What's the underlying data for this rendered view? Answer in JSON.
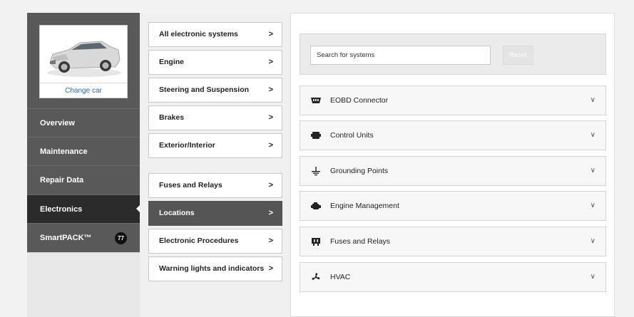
{
  "vehicle": {
    "change_label": "Change car"
  },
  "sidebar": {
    "items": [
      {
        "label": "Overview"
      },
      {
        "label": "Maintenance"
      },
      {
        "label": "Repair Data"
      },
      {
        "label": "Electronics"
      },
      {
        "label": "SmartPACK™",
        "badge": "77"
      }
    ],
    "active": "Electronics"
  },
  "submenu": {
    "items": [
      {
        "label": "All electronic systems"
      },
      {
        "label": "Engine"
      },
      {
        "label": "Steering and Suspension"
      },
      {
        "label": "Brakes"
      },
      {
        "label": "Exterior/Interior"
      },
      {
        "label": "Fuses and Relays"
      },
      {
        "label": "Locations"
      },
      {
        "label": "Electronic Procedures"
      },
      {
        "label": "Warning lights and indicators"
      }
    ],
    "chevron": ">",
    "active": "Locations"
  },
  "search": {
    "placeholder": "Search for systems",
    "reset_label": "Reset"
  },
  "systems": {
    "chevron": "∨",
    "items": [
      {
        "label": "EOBD Connector",
        "icon": "connector-icon"
      },
      {
        "label": "Control Units",
        "icon": "control-unit-icon"
      },
      {
        "label": "Grounding Points",
        "icon": "ground-icon"
      },
      {
        "label": "Engine Management",
        "icon": "engine-icon"
      },
      {
        "label": "Fuses and Relays",
        "icon": "fuse-icon"
      },
      {
        "label": "HVAC",
        "icon": "fan-icon"
      }
    ]
  },
  "colors": {
    "accent_link": "#2a6db5",
    "sidebar_bg": "#595959",
    "sidebar_active": "#2b2b2b"
  }
}
